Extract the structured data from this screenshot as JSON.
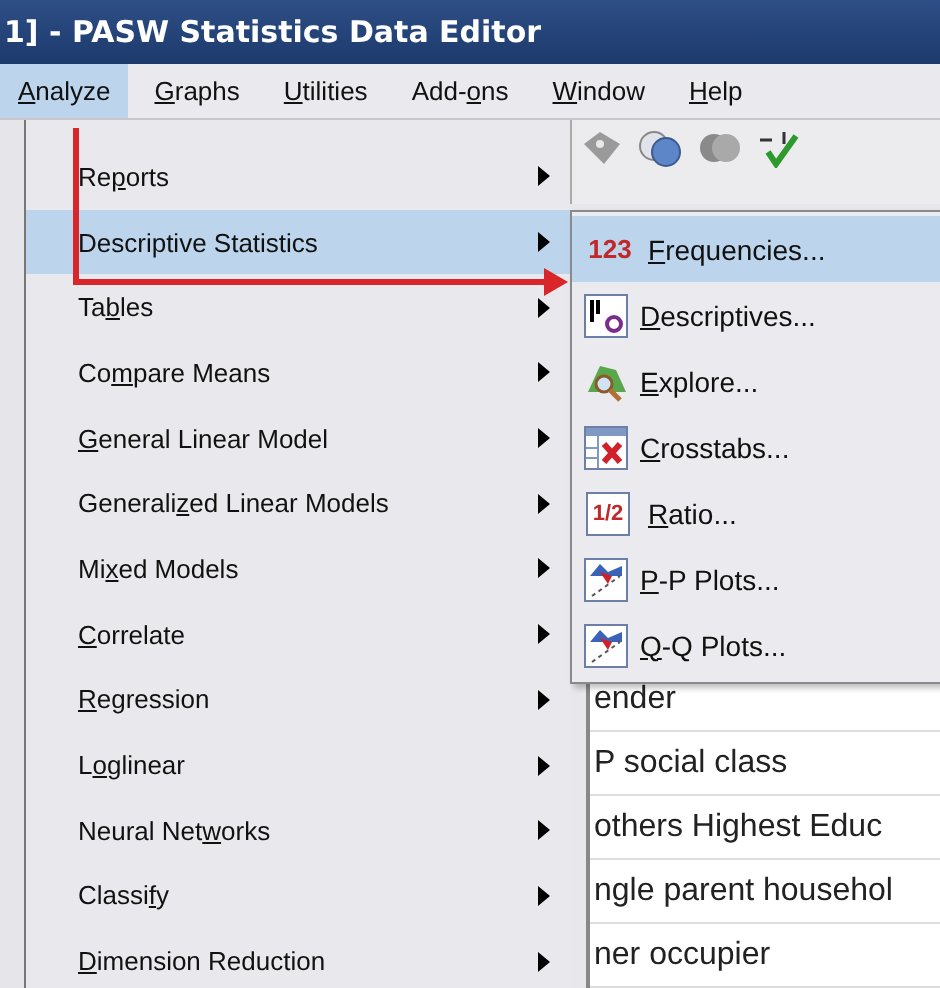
{
  "window": {
    "title": "1] - PASW Statistics Data Editor"
  },
  "menu_bar": [
    {
      "key": "A",
      "post": "nalyze",
      "selected": true
    },
    {
      "key": "G",
      "post": "raphs",
      "selected": false
    },
    {
      "key": "U",
      "post": "tilities",
      "selected": false
    },
    {
      "pre": "Add-",
      "key": "o",
      "post": "ns",
      "selected": false
    },
    {
      "key": "W",
      "post": "indow",
      "selected": false
    },
    {
      "key": "H",
      "post": "elp",
      "selected": false
    }
  ],
  "analyze_menu": [
    {
      "pre": "Re",
      "key": "p",
      "post": "orts",
      "selected": false
    },
    {
      "post": "Descriptive Statistics",
      "selected": true
    },
    {
      "pre": "Ta",
      "key": "b",
      "post": "les",
      "selected": false
    },
    {
      "pre": "Co",
      "key": "m",
      "post": "pare Means",
      "selected": false
    },
    {
      "key": "G",
      "post": "eneral Linear Model",
      "selected": false
    },
    {
      "pre": "Generali",
      "key": "z",
      "post": "ed Linear Models",
      "selected": false
    },
    {
      "pre": "Mi",
      "key": "x",
      "post": "ed Models",
      "selected": false
    },
    {
      "key": "C",
      "post": "orrelate",
      "selected": false
    },
    {
      "key": "R",
      "post": "egression",
      "selected": false
    },
    {
      "pre": "L",
      "key": "o",
      "post": "glinear",
      "selected": false
    },
    {
      "pre": "Neural Net",
      "key": "w",
      "post": "orks",
      "selected": false
    },
    {
      "pre": "Classi",
      "key": "f",
      "post": "y",
      "selected": false
    },
    {
      "key": "D",
      "post": "imension Reduction",
      "selected": false
    }
  ],
  "submenu": [
    {
      "kind": "text-icon",
      "icon_text": "123",
      "key": "F",
      "post": "requencies...",
      "selected": true
    },
    {
      "kind": "descriptives",
      "key": "D",
      "post": "escriptives...",
      "selected": false
    },
    {
      "kind": "explore",
      "key": "E",
      "post": "xplore...",
      "selected": false
    },
    {
      "kind": "crosstabs",
      "key": "C",
      "post": "rosstabs...",
      "selected": false
    },
    {
      "kind": "text-icon",
      "icon_text": "1/2",
      "key": "R",
      "post": "atio...",
      "selected": false
    },
    {
      "kind": "plot",
      "key": "P",
      "post": "-P Plots...",
      "selected": false
    },
    {
      "kind": "plot",
      "key": "Q",
      "post": "-Q Plots...",
      "selected": false
    }
  ],
  "data_rows": [
    "ender",
    "P social class",
    "others Highest Educ",
    "ngle parent househol",
    "ner occupier"
  ]
}
